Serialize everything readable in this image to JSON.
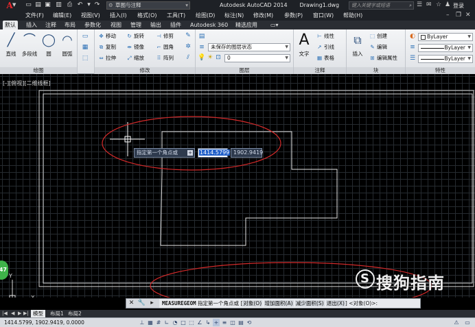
{
  "title_bar": {
    "workspace": "草图与注释",
    "app_title": "Autodesk AutoCAD 2014",
    "document": "Drawing1.dwg",
    "search_placeholder": "键入关键字或短语",
    "login": "登录"
  },
  "menu": [
    "文件(F)",
    "编辑(E)",
    "视图(V)",
    "插入(I)",
    "格式(O)",
    "工具(T)",
    "绘图(D)",
    "标注(N)",
    "修改(M)",
    "参数(P)",
    "窗口(W)",
    "帮助(H)"
  ],
  "ribbon_tabs": [
    "默认",
    "插入",
    "注释",
    "布局",
    "参数化",
    "视图",
    "管理",
    "输出",
    "插件",
    "Autodesk 360",
    "精选应用"
  ],
  "ribbon": {
    "draw": {
      "title": "绘图",
      "line": "直线",
      "polyline": "多段线",
      "circle": "圆",
      "arc": "圆弧"
    },
    "modify": {
      "title": "修改",
      "move": "移动",
      "rotate": "旋转",
      "trim": "修剪",
      "copy": "复制",
      "mirror": "镜像",
      "fillet": "圆角",
      "stretch": "拉伸",
      "scale": "缩放",
      "array": "阵列"
    },
    "layers": {
      "title": "图层",
      "state": "未保存的图层状态",
      "current_layer": "0"
    },
    "annotation": {
      "title": "注释",
      "text": "文字",
      "dim_linear": "线性",
      "leader": "引线",
      "table": "表格"
    },
    "block": {
      "title": "块",
      "insert": "插入",
      "create": "创建",
      "edit": "编辑",
      "edit_attr": "编辑属性"
    },
    "properties": {
      "title": "特性",
      "color": "ByLayer",
      "linetype": "ByLayer",
      "lineweight": "ByLayer"
    }
  },
  "canvas": {
    "view_label": "[-][俯视][二维线框]",
    "dynamic_prompt": "指定第一个角点或",
    "x_value": "1414.5799",
    "y_value": "1902.9419",
    "nav_value": "47",
    "ucs_y": "Y",
    "ucs_x": "X"
  },
  "command_line": {
    "command": "MEASUREGEOM",
    "prompt": "指定第一个角点或",
    "options": [
      "对象(O)",
      "增加面积(A)",
      "减少面积(S)",
      "退出(X)"
    ],
    "default": "<对象(O)>:"
  },
  "watermark": {
    "icon": "S",
    "text": "搜狗指南"
  },
  "layout_tabs": [
    "模型",
    "布局1",
    "布局2"
  ],
  "status": {
    "coords": "1414.5799, 1902.9419, 0.0000"
  },
  "colors": {
    "annotation_ellipse": "#d42a2a",
    "canvas_bg": "#000000",
    "grid": "#262b30",
    "dark_chrome": "#1e2126",
    "dynamic_highlight": "#1f5ec9"
  }
}
